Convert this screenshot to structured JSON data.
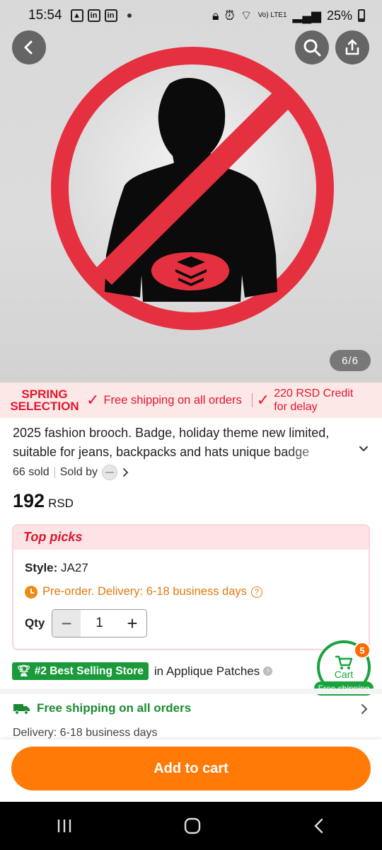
{
  "status_bar": {
    "time": "15:54",
    "battery": "25%",
    "network": "Vo) LTE1"
  },
  "gallery": {
    "counter": "6/6"
  },
  "promo": {
    "badge_line1": "SPRING",
    "badge_line2": "SELECTION",
    "free_shipping": "Free shipping on all orders",
    "credit_line1": "220 RSD Credit",
    "credit_line2": "for delay"
  },
  "product": {
    "title": "2025 fashion brooch. Badge, holiday theme new limited, suitable for jeans, backpacks and hats unique badge",
    "sold": "66 sold",
    "sold_by": "Sold by",
    "price": "192",
    "currency": "RSD"
  },
  "top_picks": {
    "header": "Top picks",
    "style_label": "Style:",
    "style_value": "JA27",
    "preorder": "Pre-order. Delivery: 6-18 business days",
    "qty_label": "Qty",
    "qty_value": "1"
  },
  "store": {
    "badge": "#2 Best Selling Store",
    "category": "in Applique Patches"
  },
  "cart_fab": {
    "label": "Cart",
    "count": "5",
    "free_shipping": "Free shipping"
  },
  "shipping": {
    "title": "Free shipping on all orders",
    "delivery": "Delivery: 6-18 business days"
  },
  "cta": {
    "add_to_cart": "Add to cart"
  },
  "colors": {
    "accent_orange": "#ff7a06",
    "promo_red": "#e3172e",
    "success_green": "#18a33e"
  }
}
